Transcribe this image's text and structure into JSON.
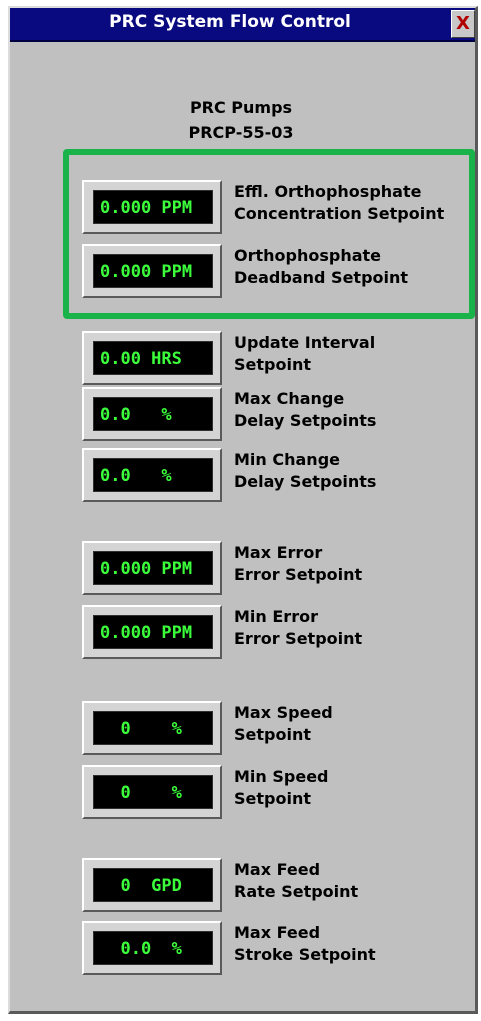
{
  "window": {
    "title": "PRC System Flow Control",
    "close_label": "X"
  },
  "header": {
    "line1": "PRC Pumps",
    "line2": "PRCP-55-03"
  },
  "setpoints": [
    {
      "value": "0.000 PPM",
      "label_line1": "Effl. Orthophosphate",
      "label_line2": "Concentration Setpoint"
    },
    {
      "value": "0.000 PPM",
      "label_line1": "Orthophosphate",
      "label_line2": "Deadband Setpoint"
    },
    {
      "value": "0.00 HRS",
      "label_line1": "Update Interval",
      "label_line2": "Setpoint"
    },
    {
      "value": "0.0   %",
      "label_line1": "Max Change",
      "label_line2": "Delay Setpoints"
    },
    {
      "value": "0.0   %",
      "label_line1": "Min Change",
      "label_line2": "Delay Setpoints"
    },
    {
      "value": "0.000 PPM",
      "label_line1": "Max Error",
      "label_line2": "Error Setpoint"
    },
    {
      "value": "0.000 PPM",
      "label_line1": "Min Error",
      "label_line2": "Error Setpoint"
    },
    {
      "value": "  0    %",
      "label_line1": "Max Speed",
      "label_line2": "Setpoint"
    },
    {
      "value": "  0    %",
      "label_line1": "Min Speed",
      "label_line2": "Setpoint"
    },
    {
      "value": "  0  GPD",
      "label_line1": "Max Feed",
      "label_line2": "Rate Setpoint"
    },
    {
      "value": "  0.0  %",
      "label_line1": "Max Feed",
      "label_line2": "Stroke Setpoint"
    }
  ],
  "colors": {
    "titlebar": "#0a0a80",
    "panel": "#c0c0c0",
    "readout_text": "#3cff3c",
    "highlight_border": "#19b34a"
  }
}
